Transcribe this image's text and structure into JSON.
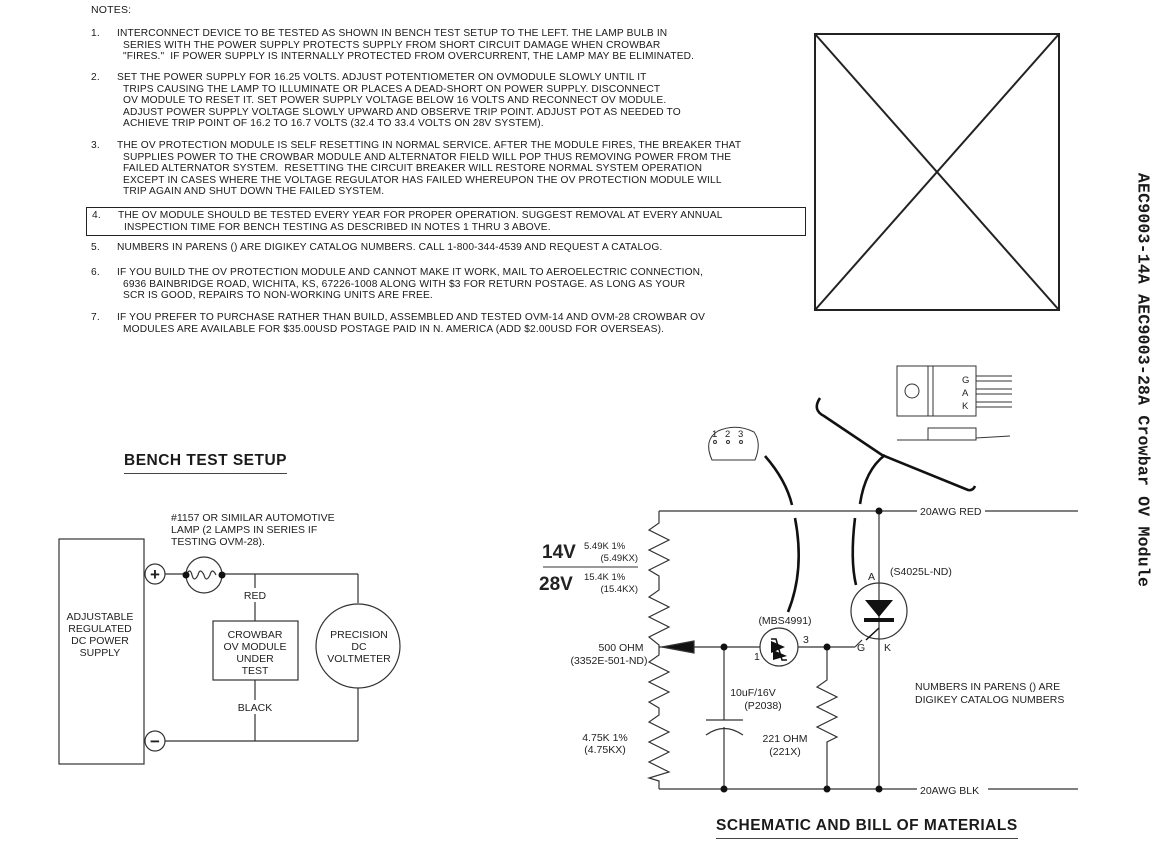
{
  "notes": {
    "title": "NOTES:",
    "items": [
      {
        "num": "1.",
        "lines": [
          "INTERCONNECT DEVICE TO BE TESTED AS SHOWN IN BENCH TEST SETUP TO THE LEFT. THE LAMP BULB IN",
          "SERIES WITH THE POWER SUPPLY PROTECTS SUPPLY FROM SHORT CIRCUIT DAMAGE WHEN CROWBAR",
          "\"FIRES.\"  IF POWER SUPPLY IS INTERNALLY PROTECTED FROM OVERCURRENT, THE LAMP MAY BE ELIMINATED."
        ]
      },
      {
        "num": "2.",
        "lines": [
          "SET THE POWER SUPPLY FOR 16.25 VOLTS. ADJUST POTENTIOMETER ON OVMODULE SLOWLY UNTIL IT",
          "TRIPS CAUSING THE LAMP TO ILLUMINATE OR PLACES A DEAD-SHORT ON POWER SUPPLY. DISCONNECT",
          "OV MODULE TO RESET IT. SET POWER SUPPLY VOLTAGE BELOW 16 VOLTS AND RECONNECT OV MODULE.",
          "ADJUST POWER SUPPLY VOLTAGE SLOWLY UPWARD AND OBSERVE TRIP POINT. ADJUST POT AS NEEDED TO",
          "ACHIEVE TRIP POINT OF 16.2 TO 16.7 VOLTS (32.4 TO 33.4 VOLTS ON 28V SYSTEM)."
        ]
      },
      {
        "num": "3.",
        "lines": [
          "THE OV PROTECTION MODULE IS SELF RESETTING IN NORMAL SERVICE. AFTER THE MODULE FIRES, THE BREAKER THAT",
          "SUPPLIES POWER TO THE CROWBAR MODULE AND ALTERNATOR FIELD WILL POP THUS REMOVING POWER FROM THE",
          "FAILED ALTERNATOR SYSTEM.  RESETTING THE CIRCUIT BREAKER WILL RESTORE NORMAL SYSTEM OPERATION",
          "EXCEPT IN CASES WHERE THE VOLTAGE REGULATOR HAS FAILED WHEREUPON THE OV PROTECTION MODULE WILL",
          "TRIP AGAIN AND SHUT DOWN THE FAILED SYSTEM."
        ]
      },
      {
        "num": "4.",
        "lines": [
          "THE OV MODULE SHOULD BE TESTED EVERY YEAR FOR PROPER OPERATION. SUGGEST REMOVAL AT EVERY ANNUAL",
          "INSPECTION TIME FOR BENCH TESTING AS DESCRIBED IN NOTES 1 THRU 3 ABOVE."
        ]
      },
      {
        "num": "5.",
        "lines": [
          "NUMBERS IN PARENS () ARE DIGIKEY CATALOG NUMBERS. CALL 1-800-344-4539 AND REQUEST A CATALOG."
        ]
      },
      {
        "num": "6.",
        "lines": [
          "IF YOU BUILD THE OV PROTECTION MODULE AND CANNOT MAKE IT WORK, MAIL TO AEROELECTRIC CONNECTION,",
          "6936 BAINBRIDGE ROAD, WICHITA, KS, 67226-1008 ALONG WITH $3 FOR RETURN POSTAGE. AS LONG AS YOUR",
          "SCR IS GOOD, REPAIRS TO NON-WORKING UNITS ARE FREE."
        ]
      },
      {
        "num": "7.",
        "lines": [
          "IF YOU PREFER TO PURCHASE RATHER THAN BUILD, ASSEMBLED AND TESTED OVM-14 AND OVM-28 CROWBAR OV",
          "MODULES ARE AVAILABLE FOR $35.00USD POSTAGE PAID IN N. AMERICA (ADD $2.00USD FOR OVERSEAS)."
        ]
      }
    ]
  },
  "side_title": "AEC9003-14A AEC9003-28A Crowbar OV Module",
  "bench": {
    "heading": "BENCH TEST SETUP",
    "lamp_note": [
      "#1157 OR SIMILAR AUTOMOTIVE",
      "LAMP (2 LAMPS IN SERIES IF",
      "TESTING OVM-28)."
    ],
    "power_supply": [
      "ADJUSTABLE",
      "REGULATED",
      "DC POWER",
      "SUPPLY"
    ],
    "plus": "+",
    "minus": "−",
    "red": "RED",
    "black": "BLACK",
    "module": [
      "CROWBAR",
      "OV MODULE",
      "UNDER",
      "TEST"
    ],
    "voltmeter": [
      "PRECISION",
      "DC",
      "VOLTMETER"
    ]
  },
  "schematic": {
    "heading": "SCHEMATIC AND BILL OF MATERIALS",
    "v14": "14V",
    "v28": "28V",
    "r14": [
      "5.49K 1%",
      "(5.49KX)"
    ],
    "r28": [
      "15.4K 1%",
      "(15.4KX)"
    ],
    "pot": [
      "500 OHM",
      "(3352E-501-ND)"
    ],
    "r_bottom": [
      "4.75K 1%",
      "(4.75KX)"
    ],
    "cap": [
      "10uF/16V",
      "(P2038)"
    ],
    "r221": [
      "221 OHM",
      "(221X)"
    ],
    "trigger": "(MBS4991)",
    "trigger_pin1": "1",
    "trigger_pin3": "3",
    "scr": "(S4025L-ND)",
    "scr_a": "A",
    "scr_k": "K",
    "scr_g": "G",
    "wire_red": "20AWG  RED",
    "wire_blk": "20AWG  BLK",
    "parens_note": [
      "NUMBERS IN PARENS () ARE",
      "DIGIKEY CATALOG NUMBERS"
    ],
    "pkg_pins": [
      "1",
      "2",
      "3"
    ],
    "to220_pins": [
      "G",
      "A",
      "K"
    ]
  }
}
